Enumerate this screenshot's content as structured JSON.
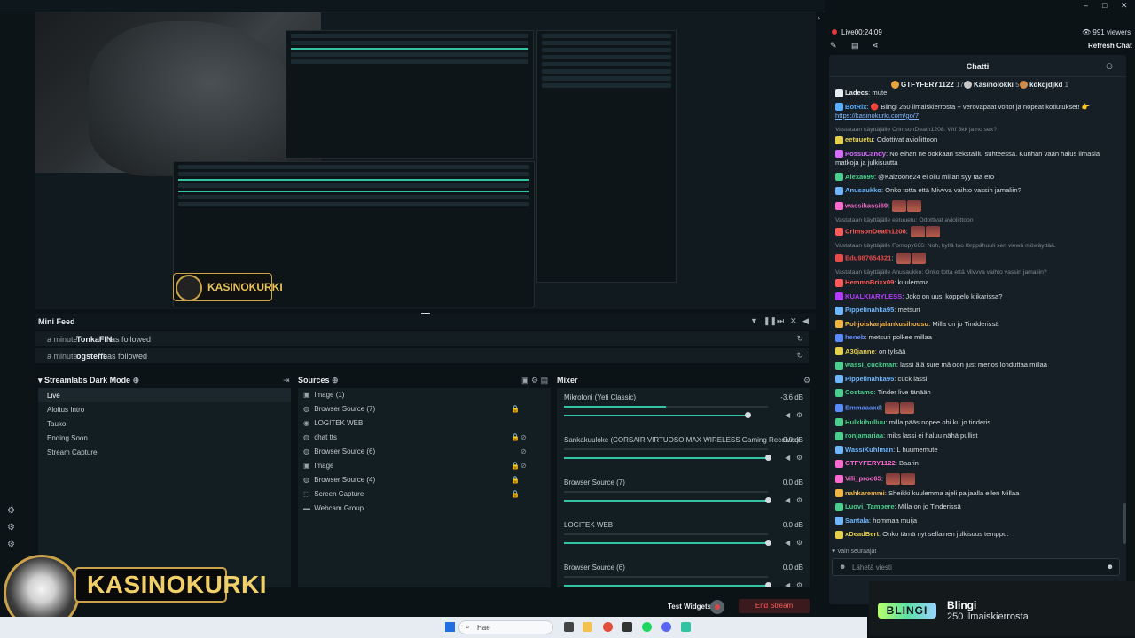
{
  "header": {
    "live_label": "Live",
    "live_time": "00:24:09",
    "viewers": "991 viewers",
    "refresh_chat": "Refresh Chat"
  },
  "window_controls": [
    "–",
    "□",
    "✕"
  ],
  "mini_feed": {
    "title": "Mini Feed",
    "events": [
      {
        "time": "a minute",
        "name": "TonkaFIN",
        "action": "has followed"
      },
      {
        "time": "a minute",
        "name": "ogsteffe",
        "action": "has followed"
      }
    ]
  },
  "scenes": {
    "title": "Streamlabs Dark Mode",
    "items": [
      "Live",
      "Aloitus Intro",
      "Tauko",
      "Ending Soon",
      "Stream Capture"
    ]
  },
  "sources": {
    "title": "Sources",
    "items": [
      {
        "label": "Image (1)",
        "icon": "image-icon"
      },
      {
        "label": "Browser Source (7)",
        "icon": "globe-icon"
      },
      {
        "label": "LOGITEK WEB",
        "icon": "camera-icon"
      },
      {
        "label": "chat tts",
        "icon": "globe-icon"
      },
      {
        "label": "Browser Source (6)",
        "icon": "globe-icon"
      },
      {
        "label": "Image",
        "icon": "image-icon"
      },
      {
        "label": "Browser Source (4)",
        "icon": "globe-icon"
      },
      {
        "label": "Screen Capture",
        "icon": "screen-icon"
      },
      {
        "label": "Webcam Group",
        "icon": "folder-icon"
      }
    ]
  },
  "mixer": {
    "title": "Mixer",
    "channels": [
      {
        "name": "Mikrofoni (Yeti Classic)",
        "db": "-3.6 dB",
        "level": 0.88
      },
      {
        "name": "Sankakuuloke (CORSAIR VIRTUOSO MAX WIRELESS Gaming Receiver)",
        "db": "0.0 dB",
        "level": 0.98
      },
      {
        "name": "Browser Source (7)",
        "db": "0.0 dB",
        "level": 0.98
      },
      {
        "name": "LOGITEK WEB",
        "db": "0.0 dB",
        "level": 0.98
      },
      {
        "name": "Browser Source (6)",
        "db": "0.0 dB",
        "level": 0.98
      }
    ]
  },
  "bottom": {
    "test_widgets": "Test Widgets",
    "end_stream": "End Stream"
  },
  "logo": {
    "text": "KASINOKURKI"
  },
  "taskbar": {
    "search_placeholder": "Hae"
  },
  "chat": {
    "title": "Chatti",
    "gifters": [
      {
        "name": "GTFYFERY1122",
        "count": "17"
      },
      {
        "name": "Kasinolokki",
        "count": "5"
      },
      {
        "name": "kdkdjdjkd",
        "count": "1"
      }
    ],
    "messages": [
      {
        "user": "Ladecs",
        "color": "#e6ecef",
        "text": "mute"
      },
      {
        "user": "BotRix",
        "color": "#5ab0ff",
        "text": "🔴 Blingi 250 ilmaiskierrosta + verovapaat voitot ja nopeat kotiutukset! 👉",
        "link": "https://kasinokurki.com/go/7"
      },
      {
        "reply": "Vastataan käyttäjälle CrimsonDeath1208: Wtf 3kk ja no sex?",
        "user": "eetuuetu",
        "color": "#e6d04a",
        "text": "Odottivat avioliittoon"
      },
      {
        "user": "PossuCandy",
        "color": "#d86cff",
        "text": "No eihän ne ookkaan sekstaillu suhteessa. Kunhan vaan halus ilmasia matkoja ja julkisuutta"
      },
      {
        "user": "Alexa699",
        "color": "#4ad08c",
        "text": "@Kalzoone24 ei ollu millan syy tää ero"
      },
      {
        "user": "Anusaukko",
        "color": "#6fb6ff",
        "text": "Onko totta että Mivvva vaihto vassin jamaliin?"
      },
      {
        "user": "wassikassi69",
        "color": "#ff6ad0",
        "text": ""
      },
      {
        "reply": "Vastataan käyttäjälle eetuuetu: Odottivat avioliittoon",
        "user": "CrimsonDeath1208",
        "color": "#ff5a5a",
        "text": ""
      },
      {
        "reply": "Vastataan käyttäjälle Fomopy666: Noh, kyllä tuo lörppähuuli sen viewä möwäyttää.",
        "user": "Edu987654321",
        "color": "#e84a4a",
        "text": ""
      },
      {
        "reply": "Vastataan käyttäjälle Anusaukko: Onko totta että Mivvva vaihto vassin jamaliin?",
        "user": "HemmoBrixx09",
        "color": "#ff5a5a",
        "text": "kuulemma"
      },
      {
        "user": "KUALKIARYLESS",
        "color": "#b53cff",
        "text": "Joko on uusi koppelo kiikarissa?"
      },
      {
        "user": "Pippelinahka95",
        "color": "#6fb6ff",
        "text": "metsuri"
      },
      {
        "user": "Pohjoiskarjalankusihousu",
        "color": "#f2b544",
        "text": "Milla on jo Tindderissä"
      },
      {
        "user": "heneb",
        "color": "#5a8cff",
        "text": "metsuri polkee millaa"
      },
      {
        "user": "A30janne",
        "color": "#e6d04a",
        "text": "on tylsää"
      },
      {
        "user": "wassi_cuckman",
        "color": "#4ad08c",
        "text": "lassi älä sure mä oon just menos lohduttaa millaa"
      },
      {
        "user": "Pippelinahka95",
        "color": "#6fb6ff",
        "text": "cuck lassi"
      },
      {
        "user": "Costamo",
        "color": "#4ad08c",
        "text": "Tinder live tänään"
      },
      {
        "user": "Emmaaaxd",
        "color": "#5a8cff",
        "text": ""
      },
      {
        "user": "Hulkkihulluu",
        "color": "#4ad08c",
        "text": "milla pääs nopee ohi ku jo tinderis"
      },
      {
        "user": "ronjamariaa",
        "color": "#4ad08c",
        "text": "miks lassi ei haluu nähä pullist"
      },
      {
        "user": "WassiKuhlman",
        "color": "#6fb6ff",
        "text": "L huumemute"
      },
      {
        "user": "GTFYFERY1122",
        "color": "#ff6ad0",
        "text": "Baarin"
      },
      {
        "user": "Vili_proo65",
        "color": "#ff6ad0",
        "text": ""
      },
      {
        "user": "nahkaremmi",
        "color": "#f2b544",
        "text": "Sheikki kuulemma ajeli paljaalla eilen Millaa"
      },
      {
        "user": "Luovi_Tampere",
        "color": "#4ad08c",
        "text": "Milla on jo Tinderissä"
      },
      {
        "user": "Santala",
        "color": "#6fb6ff",
        "text": "hommaa muija"
      },
      {
        "user": "xDeadBert",
        "color": "#e6d04a",
        "text": "Onko tämä nyt sellainen julkisuus temppu."
      }
    ],
    "follow_only": "Vain seuraajat",
    "input_placeholder": "Lähetä viesti"
  },
  "blingi_card": {
    "logo": "BLINGI",
    "name": "Blingi",
    "subtitle": "250 ilmaiskierrosta"
  }
}
